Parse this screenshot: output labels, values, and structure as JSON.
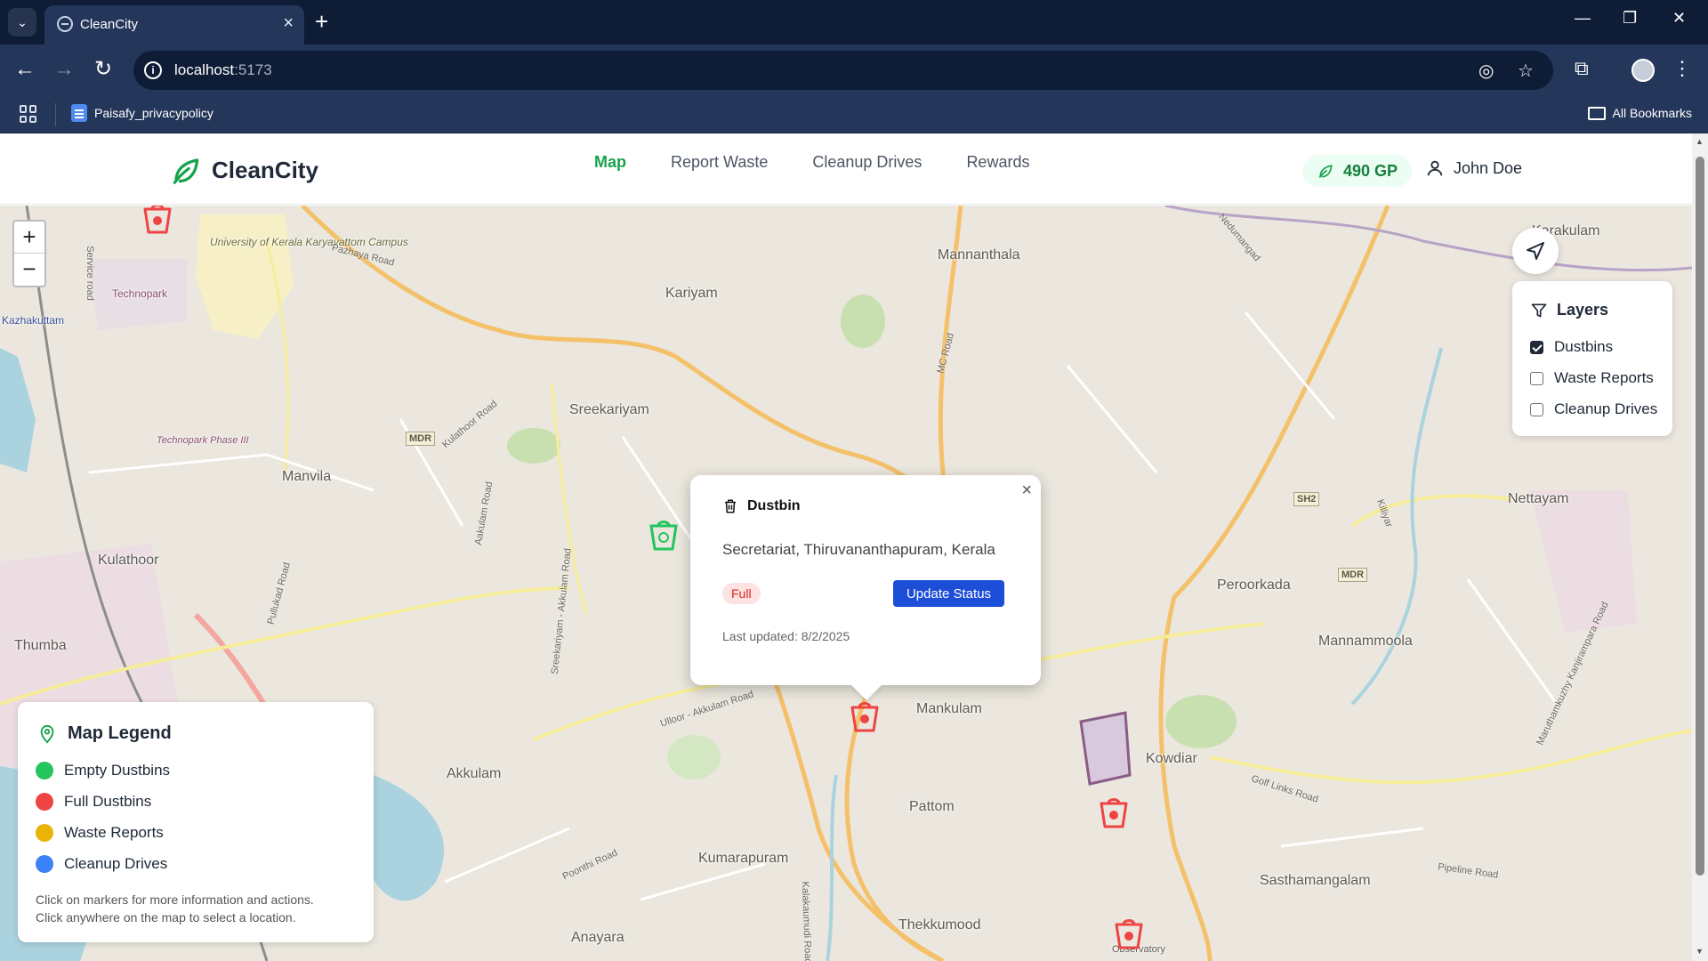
{
  "browser": {
    "tab_title": "CleanCity",
    "url_host": "localhost",
    "url_port": ":5173",
    "bookmark_label": "Paisafy_privacypolicy",
    "all_bookmarks_label": "All Bookmarks"
  },
  "app": {
    "name": "CleanCity",
    "nav": [
      {
        "label": "Map",
        "active": true
      },
      {
        "label": "Report Waste",
        "active": false
      },
      {
        "label": "Cleanup Drives",
        "active": false
      },
      {
        "label": "Rewards",
        "active": false
      }
    ],
    "points": "490 GP",
    "user_name": "John Doe",
    "brand_color": "#16a34a"
  },
  "map": {
    "zoom_in": "+",
    "zoom_out": "−",
    "places": [
      "University of Kerala Karyavattom Campus",
      "Technopark",
      "Kazhakuttam",
      "Kariyam",
      "Mannanthala",
      "Karakulam",
      "Sreekariyam",
      "Technopark Phase III",
      "Manvila",
      "Kulathoor",
      "Thumba",
      "Nettayam",
      "Peroorkada",
      "Mannammoola",
      "Mankulam",
      "Kowdiar",
      "Pattom",
      "Akkulam",
      "Kumarapuram",
      "Sasthamangalam",
      "Thekkumood",
      "Anayara",
      "Observatory"
    ],
    "roads": [
      "Pazhaya Road",
      "Service road",
      "MC Road",
      "Kulathoor Road",
      "Aakulam Road",
      "Pullukad Road",
      "Sreekariyam - Akkulam Road",
      "Ulloor - Akkulam Road",
      "Golf Links Road",
      "Poonthi Road",
      "Pipeline Road",
      "Kalakaumudi Road",
      "Nedumangad",
      "Killiyar",
      "Maruthamkuzhy Kanjirampara Road"
    ],
    "shields": [
      "MDR",
      "SH2",
      "MDR"
    ],
    "popup": {
      "title": "Dustbin",
      "address": "Secretariat, Thiruvananthapuram, Kerala",
      "status": "Full",
      "button": "Update Status",
      "last_updated": "Last updated: 8/2/2025",
      "close": "×"
    },
    "layers": {
      "title": "Layers",
      "items": [
        {
          "label": "Dustbins",
          "checked": true
        },
        {
          "label": "Waste Reports",
          "checked": false
        },
        {
          "label": "Cleanup Drives",
          "checked": false
        }
      ]
    },
    "legend": {
      "title": "Map Legend",
      "items": [
        {
          "label": "Empty Dustbins",
          "color": "#22c55e"
        },
        {
          "label": "Full Dustbins",
          "color": "#ef4444"
        },
        {
          "label": "Waste Reports",
          "color": "#eab308"
        },
        {
          "label": "Cleanup Drives",
          "color": "#3b82f6"
        }
      ],
      "note_line1": "Click on markers for more information and actions.",
      "note_line2": "Click anywhere on the map to select a location."
    },
    "colors": {
      "full": "#ef4444",
      "empty": "#22c55e"
    }
  }
}
